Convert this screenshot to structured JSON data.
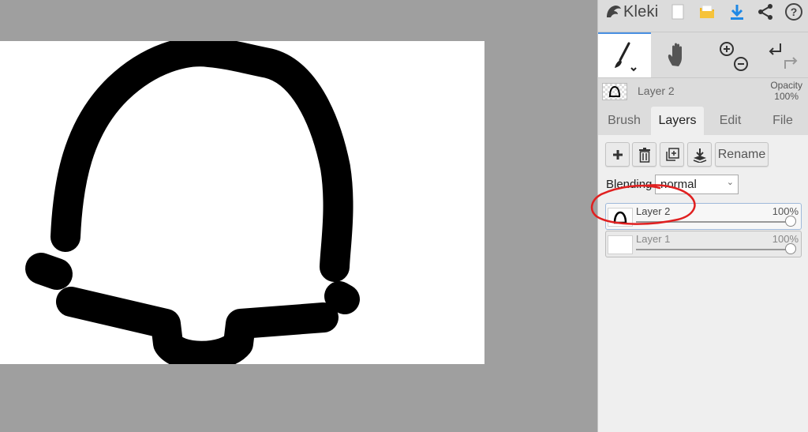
{
  "app": {
    "name": "Kleki"
  },
  "toolbar_icons": [
    "new-document-icon",
    "open-folder-icon",
    "download-icon",
    "share-icon",
    "help-icon"
  ],
  "tools": [
    "brush-tool",
    "hand-tool",
    "zoom-in",
    "zoom-out",
    "undo",
    "redo"
  ],
  "active_layer": {
    "name": "Layer 2",
    "opacity_label": "Opacity",
    "opacity_value": "100%"
  },
  "tabs": [
    "Brush",
    "Layers",
    "Edit",
    "File"
  ],
  "active_tab": "Layers",
  "layer_actions": {
    "rename_label": "Rename"
  },
  "blending": {
    "label": "Blending",
    "value": "normal"
  },
  "layers": [
    {
      "name": "Layer 2",
      "opacity": "100%",
      "opacity_fraction": 1.0,
      "selected": true
    },
    {
      "name": "Layer 1",
      "opacity": "100%",
      "opacity_fraction": 1.0,
      "selected": false
    }
  ],
  "colors": {
    "accent": "#4a90e2",
    "download": "#1e88e5",
    "folder": "#f2b51d",
    "annotation": "#e02020"
  }
}
